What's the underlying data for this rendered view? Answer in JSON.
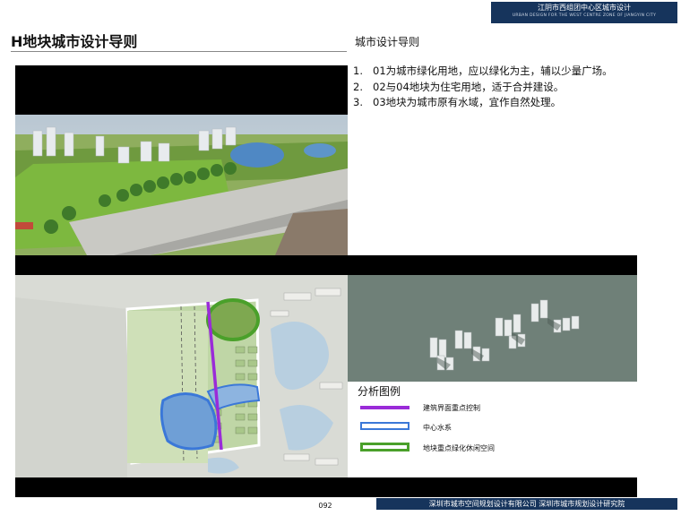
{
  "header": {
    "project_cn": "江阴市西组团中心区城市设计",
    "project_en": "URBAN DESIGN FOR THE WEST CENTRE ZONE OF JIANGYIN CITY"
  },
  "page_title": "H地块城市设计导则",
  "guide": {
    "title": "城市设计导则",
    "items": [
      {
        "num": "1.",
        "text": "01为城市绿化用地，应以绿化为主，辅以少量广场。"
      },
      {
        "num": "2.",
        "text": "02与04地块为住宅用地，适于合并建设。"
      },
      {
        "num": "3.",
        "text": "03地块为城市原有水域，宜作自然处理。"
      }
    ]
  },
  "legend": {
    "title": "分析图例",
    "items": [
      {
        "label": "建筑界面重点控制",
        "color": "#9a2bd8"
      },
      {
        "label": "中心水系",
        "color": "#3b78d8"
      },
      {
        "label": "地块重点绿化休闲空间",
        "color": "#4aa02a"
      }
    ]
  },
  "footer": {
    "page_number": "092",
    "org": "深圳市城市空间规划设计有限公司  深圳市城市规划设计研究院"
  },
  "colors": {
    "header_band": "#16345c",
    "building_interface": "#9a2bd8",
    "water_system": "#3b78d8",
    "green_space": "#4aa02a"
  }
}
